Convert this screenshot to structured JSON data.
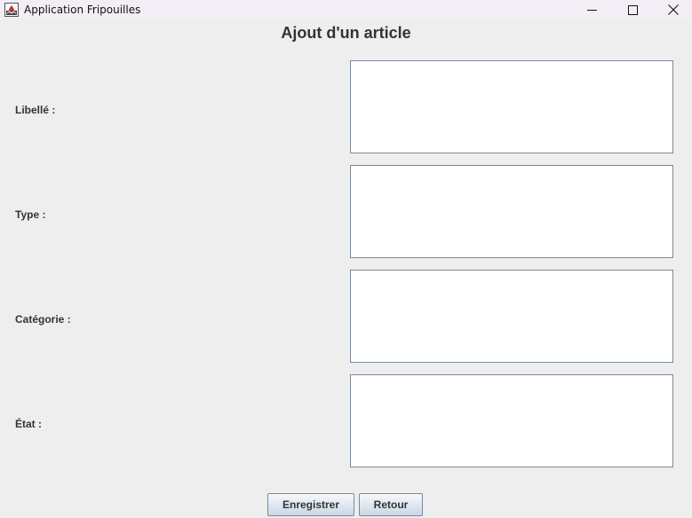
{
  "window": {
    "title": "Application Fripouilles",
    "icon": "java-app-icon",
    "controls": {
      "minimize": "minimize-icon",
      "maximize": "maximize-icon",
      "close": "close-icon"
    }
  },
  "form": {
    "title": "Ajout d'un article",
    "fields": [
      {
        "label": "Libellé :",
        "value": ""
      },
      {
        "label": "Type :",
        "value": ""
      },
      {
        "label": "Catégorie :",
        "value": ""
      },
      {
        "label": "État :",
        "value": ""
      }
    ]
  },
  "buttons": {
    "save_label": "Enregistrer",
    "back_label": "Retour"
  },
  "colors": {
    "background": "#eeeeee",
    "titlebar": "#f3eef5",
    "field_border": "#7a8a99"
  }
}
